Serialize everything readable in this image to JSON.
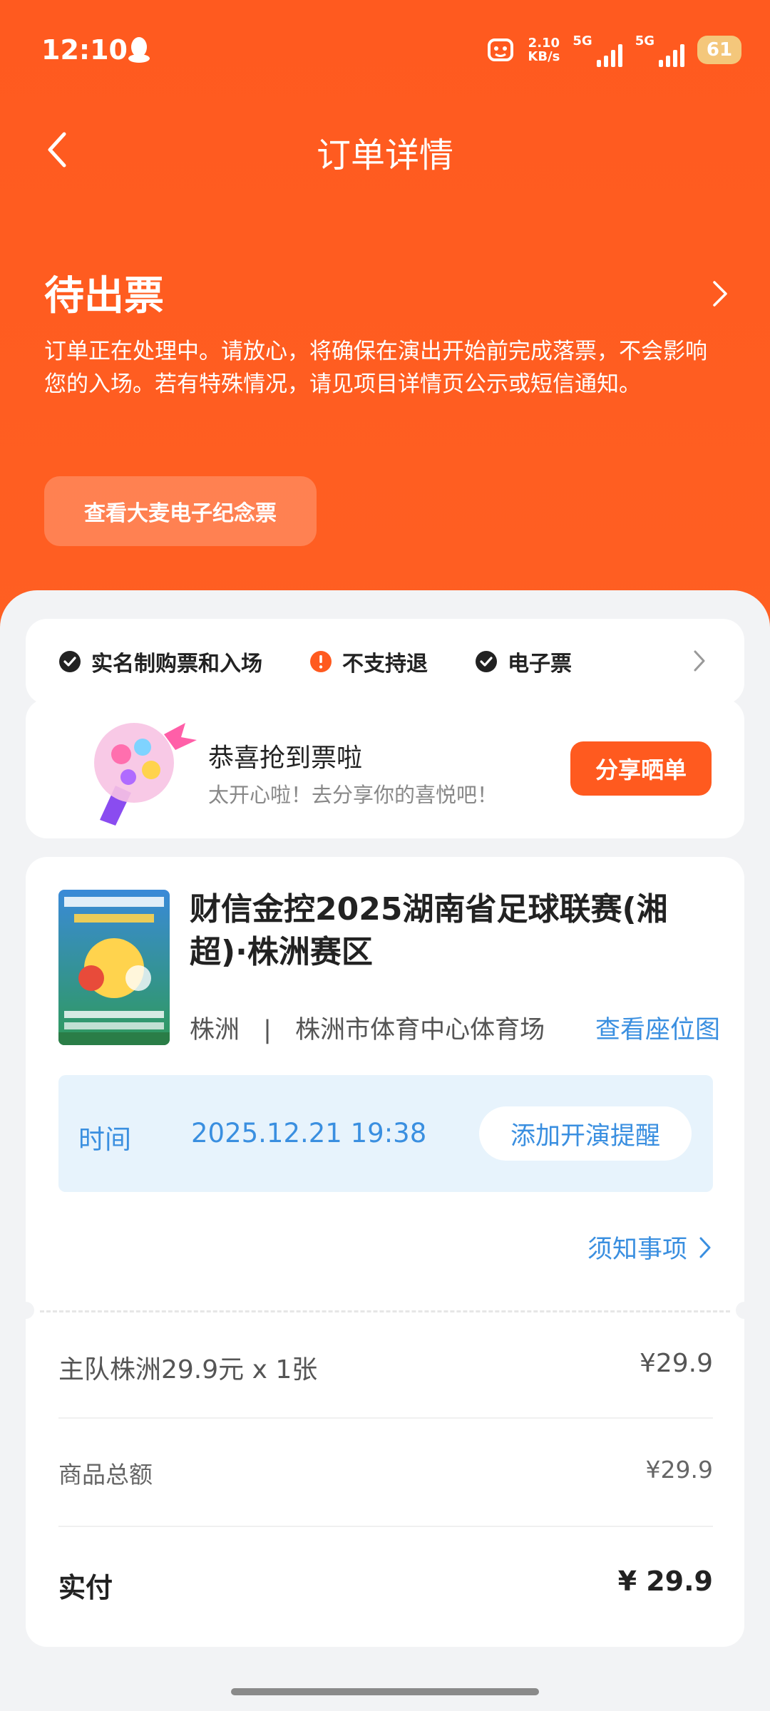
{
  "status_bar": {
    "time": "12:10",
    "speed_value": "2.10",
    "speed_unit": "KB/s",
    "net1": "5G",
    "net2": "5G",
    "battery": "61"
  },
  "header": {
    "title": "订单详情"
  },
  "order": {
    "status": "待出票",
    "description": "订单正在处理中。请放心，将确保在演出开始前完成落票，不会影响您的入场。若有特殊情况，请见项目详情页公示或短信通知。",
    "memorial_button": "查看大麦电子纪念票"
  },
  "policies": [
    {
      "label": "实名制购票和入场",
      "icon": "check-circle-icon"
    },
    {
      "label": "不支持退",
      "icon": "warning-circle-icon"
    },
    {
      "label": "电子票",
      "icon": "check-circle-icon"
    }
  ],
  "congrats": {
    "title": "恭喜抢到票啦",
    "subtitle": "太开心啦！去分享你的喜悦吧！",
    "share_button": "分享晒单"
  },
  "event": {
    "title": "财信金控2025湖南省足球联赛(湘超)·株洲赛区",
    "city": "株洲",
    "separator": "|",
    "venue": "株洲市体育中心体育场",
    "seat_map_link": "查看座位图",
    "time_label": "时间",
    "time_value": "2025.12.21 19:38",
    "reminder_button": "添加开演提醒",
    "notice_link": "须知事项"
  },
  "price": {
    "item_label": "主队株洲29.9元 x 1张",
    "item_price": "¥29.9",
    "subtotal_label": "商品总额",
    "subtotal_price": "¥29.9",
    "paid_label": "实付",
    "paid_price": "¥ 29.9"
  },
  "colors": {
    "brand": "#ff5a1f",
    "link": "#3a8fe0",
    "time_bg": "#e7f3fc"
  }
}
